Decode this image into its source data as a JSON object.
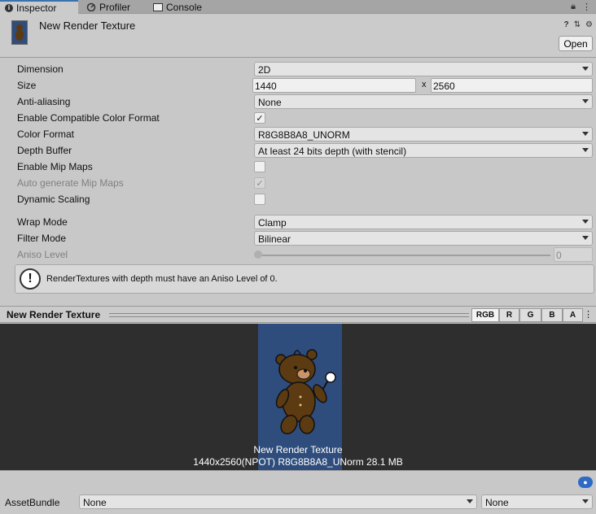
{
  "tabs": [
    {
      "label": "Inspector",
      "icon": "info-icon"
    },
    {
      "label": "Profiler",
      "icon": "profiler-icon"
    },
    {
      "label": "Console",
      "icon": "console-icon"
    }
  ],
  "header": {
    "title": "New Render Texture",
    "open_label": "Open"
  },
  "properties": {
    "dimension": {
      "label": "Dimension",
      "value": "2D"
    },
    "size": {
      "label": "Size",
      "width": "1440",
      "x": "x",
      "height": "2560"
    },
    "anti_aliasing": {
      "label": "Anti-aliasing",
      "value": "None"
    },
    "compat_format": {
      "label": "Enable Compatible Color Format",
      "checked": "✓"
    },
    "color_format": {
      "label": "Color Format",
      "value": "R8G8B8A8_UNORM"
    },
    "depth_buffer": {
      "label": "Depth Buffer",
      "value": "At least 24 bits depth (with stencil)"
    },
    "mip_maps": {
      "label": "Enable Mip Maps"
    },
    "auto_mips": {
      "label": "Auto generate Mip Maps",
      "checked": "✓"
    },
    "dynamic_scaling": {
      "label": "Dynamic Scaling"
    },
    "wrap_mode": {
      "label": "Wrap Mode",
      "value": "Clamp"
    },
    "filter_mode": {
      "label": "Filter Mode",
      "value": "Bilinear"
    },
    "aniso_level": {
      "label": "Aniso Level",
      "value": "0"
    }
  },
  "help": {
    "icon_text": "!",
    "message": "RenderTextures with depth must have an Aniso Level of 0."
  },
  "preview": {
    "title": "New Render Texture",
    "channels": [
      "RGB",
      "R",
      "G",
      "B",
      "A"
    ],
    "name": "New Render Texture",
    "info": "1440x2560(NPOT)  R8G8B8A8_UNorm  28.1 MB"
  },
  "asset_bundle": {
    "label": "AssetBundle",
    "name_value": "None",
    "variant_value": "None"
  },
  "colors": {
    "accent": "#3a72b0",
    "texture_bg": "#2f4d7c",
    "bear": "#5c3a12"
  }
}
